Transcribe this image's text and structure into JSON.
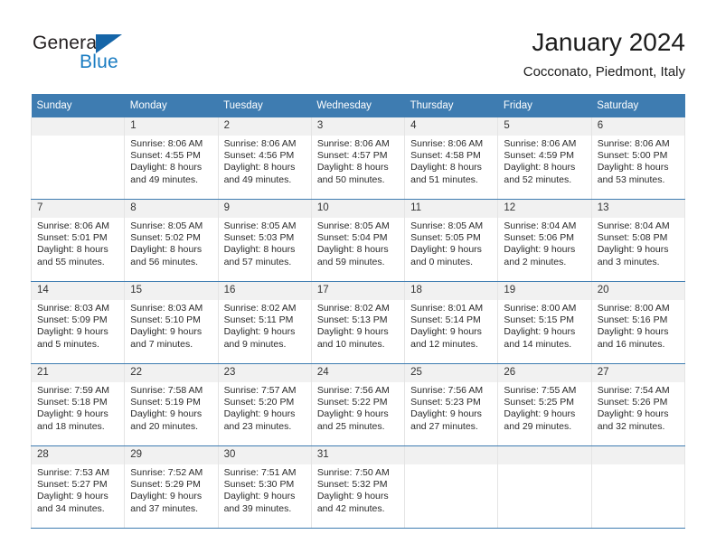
{
  "brand": {
    "name_top": "General",
    "name_bottom": "Blue",
    "accent_color": "#1a7cc2",
    "triangle_color": "#1565a8"
  },
  "header": {
    "title": "January 2024",
    "subtitle": "Cocconato, Piedmont, Italy"
  },
  "theme": {
    "header_row_bg": "#3e7cb1",
    "daynum_bg": "#f1f1f1",
    "cell_bg": "#ffffff",
    "text_color": "#2a2a2a"
  },
  "weekday_headers": [
    "Sunday",
    "Monday",
    "Tuesday",
    "Wednesday",
    "Thursday",
    "Friday",
    "Saturday"
  ],
  "weeks": [
    [
      {
        "day": "",
        "sunrise": "",
        "sunset": "",
        "daylight1": "",
        "daylight2": ""
      },
      {
        "day": "1",
        "sunrise": "Sunrise: 8:06 AM",
        "sunset": "Sunset: 4:55 PM",
        "daylight1": "Daylight: 8 hours",
        "daylight2": "and 49 minutes."
      },
      {
        "day": "2",
        "sunrise": "Sunrise: 8:06 AM",
        "sunset": "Sunset: 4:56 PM",
        "daylight1": "Daylight: 8 hours",
        "daylight2": "and 49 minutes."
      },
      {
        "day": "3",
        "sunrise": "Sunrise: 8:06 AM",
        "sunset": "Sunset: 4:57 PM",
        "daylight1": "Daylight: 8 hours",
        "daylight2": "and 50 minutes."
      },
      {
        "day": "4",
        "sunrise": "Sunrise: 8:06 AM",
        "sunset": "Sunset: 4:58 PM",
        "daylight1": "Daylight: 8 hours",
        "daylight2": "and 51 minutes."
      },
      {
        "day": "5",
        "sunrise": "Sunrise: 8:06 AM",
        "sunset": "Sunset: 4:59 PM",
        "daylight1": "Daylight: 8 hours",
        "daylight2": "and 52 minutes."
      },
      {
        "day": "6",
        "sunrise": "Sunrise: 8:06 AM",
        "sunset": "Sunset: 5:00 PM",
        "daylight1": "Daylight: 8 hours",
        "daylight2": "and 53 minutes."
      }
    ],
    [
      {
        "day": "7",
        "sunrise": "Sunrise: 8:06 AM",
        "sunset": "Sunset: 5:01 PM",
        "daylight1": "Daylight: 8 hours",
        "daylight2": "and 55 minutes."
      },
      {
        "day": "8",
        "sunrise": "Sunrise: 8:05 AM",
        "sunset": "Sunset: 5:02 PM",
        "daylight1": "Daylight: 8 hours",
        "daylight2": "and 56 minutes."
      },
      {
        "day": "9",
        "sunrise": "Sunrise: 8:05 AM",
        "sunset": "Sunset: 5:03 PM",
        "daylight1": "Daylight: 8 hours",
        "daylight2": "and 57 minutes."
      },
      {
        "day": "10",
        "sunrise": "Sunrise: 8:05 AM",
        "sunset": "Sunset: 5:04 PM",
        "daylight1": "Daylight: 8 hours",
        "daylight2": "and 59 minutes."
      },
      {
        "day": "11",
        "sunrise": "Sunrise: 8:05 AM",
        "sunset": "Sunset: 5:05 PM",
        "daylight1": "Daylight: 9 hours",
        "daylight2": "and 0 minutes."
      },
      {
        "day": "12",
        "sunrise": "Sunrise: 8:04 AM",
        "sunset": "Sunset: 5:06 PM",
        "daylight1": "Daylight: 9 hours",
        "daylight2": "and 2 minutes."
      },
      {
        "day": "13",
        "sunrise": "Sunrise: 8:04 AM",
        "sunset": "Sunset: 5:08 PM",
        "daylight1": "Daylight: 9 hours",
        "daylight2": "and 3 minutes."
      }
    ],
    [
      {
        "day": "14",
        "sunrise": "Sunrise: 8:03 AM",
        "sunset": "Sunset: 5:09 PM",
        "daylight1": "Daylight: 9 hours",
        "daylight2": "and 5 minutes."
      },
      {
        "day": "15",
        "sunrise": "Sunrise: 8:03 AM",
        "sunset": "Sunset: 5:10 PM",
        "daylight1": "Daylight: 9 hours",
        "daylight2": "and 7 minutes."
      },
      {
        "day": "16",
        "sunrise": "Sunrise: 8:02 AM",
        "sunset": "Sunset: 5:11 PM",
        "daylight1": "Daylight: 9 hours",
        "daylight2": "and 9 minutes."
      },
      {
        "day": "17",
        "sunrise": "Sunrise: 8:02 AM",
        "sunset": "Sunset: 5:13 PM",
        "daylight1": "Daylight: 9 hours",
        "daylight2": "and 10 minutes."
      },
      {
        "day": "18",
        "sunrise": "Sunrise: 8:01 AM",
        "sunset": "Sunset: 5:14 PM",
        "daylight1": "Daylight: 9 hours",
        "daylight2": "and 12 minutes."
      },
      {
        "day": "19",
        "sunrise": "Sunrise: 8:00 AM",
        "sunset": "Sunset: 5:15 PM",
        "daylight1": "Daylight: 9 hours",
        "daylight2": "and 14 minutes."
      },
      {
        "day": "20",
        "sunrise": "Sunrise: 8:00 AM",
        "sunset": "Sunset: 5:16 PM",
        "daylight1": "Daylight: 9 hours",
        "daylight2": "and 16 minutes."
      }
    ],
    [
      {
        "day": "21",
        "sunrise": "Sunrise: 7:59 AM",
        "sunset": "Sunset: 5:18 PM",
        "daylight1": "Daylight: 9 hours",
        "daylight2": "and 18 minutes."
      },
      {
        "day": "22",
        "sunrise": "Sunrise: 7:58 AM",
        "sunset": "Sunset: 5:19 PM",
        "daylight1": "Daylight: 9 hours",
        "daylight2": "and 20 minutes."
      },
      {
        "day": "23",
        "sunrise": "Sunrise: 7:57 AM",
        "sunset": "Sunset: 5:20 PM",
        "daylight1": "Daylight: 9 hours",
        "daylight2": "and 23 minutes."
      },
      {
        "day": "24",
        "sunrise": "Sunrise: 7:56 AM",
        "sunset": "Sunset: 5:22 PM",
        "daylight1": "Daylight: 9 hours",
        "daylight2": "and 25 minutes."
      },
      {
        "day": "25",
        "sunrise": "Sunrise: 7:56 AM",
        "sunset": "Sunset: 5:23 PM",
        "daylight1": "Daylight: 9 hours",
        "daylight2": "and 27 minutes."
      },
      {
        "day": "26",
        "sunrise": "Sunrise: 7:55 AM",
        "sunset": "Sunset: 5:25 PM",
        "daylight1": "Daylight: 9 hours",
        "daylight2": "and 29 minutes."
      },
      {
        "day": "27",
        "sunrise": "Sunrise: 7:54 AM",
        "sunset": "Sunset: 5:26 PM",
        "daylight1": "Daylight: 9 hours",
        "daylight2": "and 32 minutes."
      }
    ],
    [
      {
        "day": "28",
        "sunrise": "Sunrise: 7:53 AM",
        "sunset": "Sunset: 5:27 PM",
        "daylight1": "Daylight: 9 hours",
        "daylight2": "and 34 minutes."
      },
      {
        "day": "29",
        "sunrise": "Sunrise: 7:52 AM",
        "sunset": "Sunset: 5:29 PM",
        "daylight1": "Daylight: 9 hours",
        "daylight2": "and 37 minutes."
      },
      {
        "day": "30",
        "sunrise": "Sunrise: 7:51 AM",
        "sunset": "Sunset: 5:30 PM",
        "daylight1": "Daylight: 9 hours",
        "daylight2": "and 39 minutes."
      },
      {
        "day": "31",
        "sunrise": "Sunrise: 7:50 AM",
        "sunset": "Sunset: 5:32 PM",
        "daylight1": "Daylight: 9 hours",
        "daylight2": "and 42 minutes."
      },
      {
        "day": "",
        "sunrise": "",
        "sunset": "",
        "daylight1": "",
        "daylight2": ""
      },
      {
        "day": "",
        "sunrise": "",
        "sunset": "",
        "daylight1": "",
        "daylight2": ""
      },
      {
        "day": "",
        "sunrise": "",
        "sunset": "",
        "daylight1": "",
        "daylight2": ""
      }
    ]
  ]
}
